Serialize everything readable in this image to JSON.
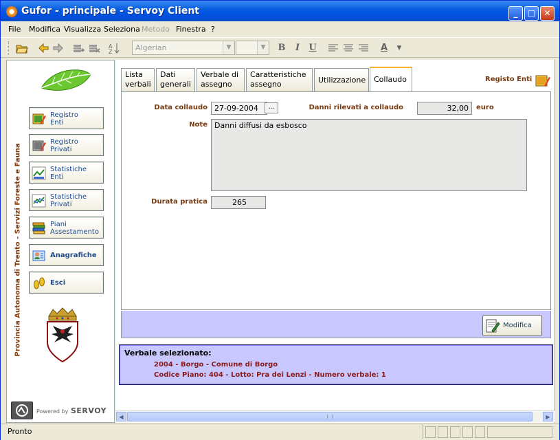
{
  "window": {
    "title": "Gufor - principale - Servoy Client",
    "controls": {
      "minimize": "_",
      "maximize": "□",
      "close": "✕"
    }
  },
  "menu": {
    "items": [
      "File",
      "Modifica",
      "Visualizza",
      "Seleziona",
      "Metodo",
      "Finestra",
      "?"
    ],
    "disabled": [
      "Metodo"
    ]
  },
  "toolbar": {
    "font_value": "Algerian",
    "size_value": "",
    "bold": "B",
    "italic": "I",
    "underline": "U",
    "font_color": "A"
  },
  "sidebar": {
    "vertical_title": "Provincia Autonoma di Trento - Servizi Foreste e Fauna",
    "buttons": [
      {
        "line1": "Registro",
        "line2": "Enti",
        "icon": "book-pencil-icon"
      },
      {
        "line1": "Registro",
        "line2": "Privati",
        "icon": "book-grey-icon"
      },
      {
        "line1": "Statistiche",
        "line2": "Enti",
        "icon": "chart-icon"
      },
      {
        "line1": "Statistiche",
        "line2": "Privati",
        "icon": "chart-icon"
      },
      {
        "line1": "Piani",
        "line2": "Assestamento",
        "icon": "books-icon"
      },
      {
        "line1": "Anagrafiche",
        "line2": "",
        "icon": "person-card-icon"
      },
      {
        "line1": "Esci",
        "line2": "",
        "icon": "footprints-icon"
      }
    ],
    "powered_by": "Powered by",
    "brand": "SERVOY"
  },
  "tabs": [
    {
      "line1": "Lista",
      "line2": "verbali"
    },
    {
      "line1": "Dati",
      "line2": "generali"
    },
    {
      "line1": "Verbale di",
      "line2": "assegno"
    },
    {
      "line1": "Caratteristiche",
      "line2": "assegno"
    },
    {
      "line1": "Utilizzazione",
      "line2": ""
    },
    {
      "line1": "Collaudo",
      "line2": ""
    }
  ],
  "active_tab": "Collaudo",
  "registo_link": "Registo Enti",
  "form": {
    "data_collaudo_label": "Data collaudo",
    "data_collaudo_value": "27-09-2004",
    "date_button": "...",
    "danni_label": "Danni rilevati a collaudo",
    "danni_value": "32,00",
    "danni_unit": "euro",
    "note_label": "Note",
    "note_value": "Danni diffusi da esbosco",
    "durata_label": "Durata pratica",
    "durata_value": "265"
  },
  "modifica_button": "Modifica",
  "selected": {
    "heading": "Verbale selezionato:",
    "line1": "2004 - Borgo - Comune di Borgo",
    "line2": "Codice Piano: 404 - Lotto: Pra dei Lenzi - Numero verbale: 1"
  },
  "status": "Pronto",
  "colors": {
    "titlebar": "#0054e3",
    "label_brown": "#7a3a10",
    "panel_lavender": "#c8c8ff"
  }
}
